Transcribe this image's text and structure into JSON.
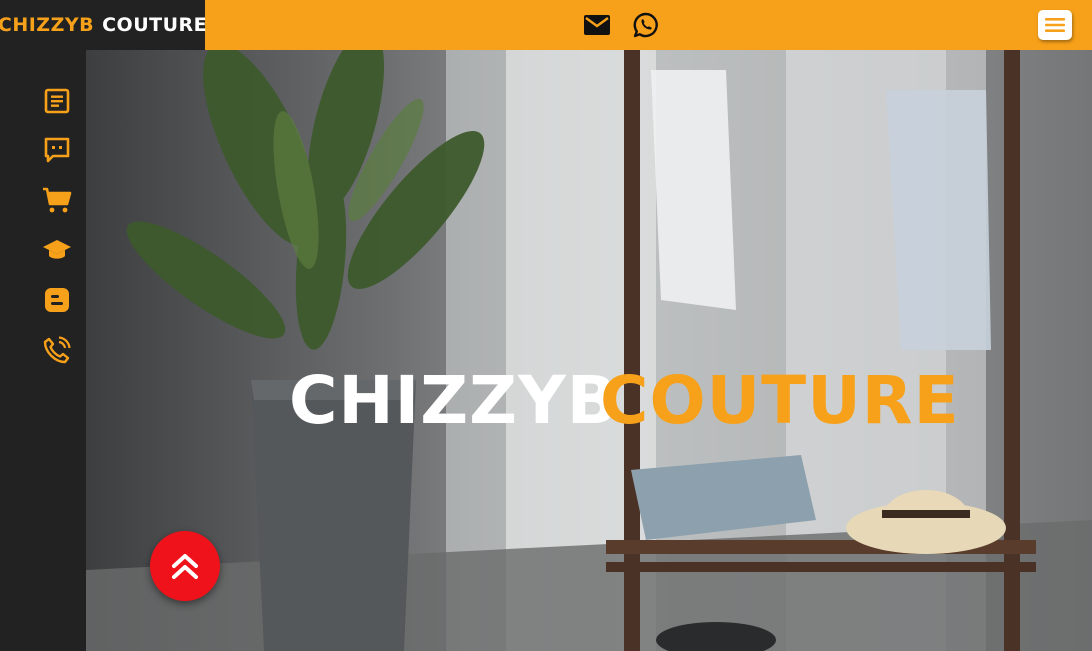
{
  "brand": {
    "part1": "CHIZZYB",
    "part2": "COUTURE"
  },
  "header": {
    "icons": [
      "mail-icon",
      "whatsapp-icon"
    ],
    "menu_icon": "hamburger-menu-icon"
  },
  "sidebar": {
    "items": [
      {
        "icon": "article-icon"
      },
      {
        "icon": "chat-icon"
      },
      {
        "icon": "cart-icon"
      },
      {
        "icon": "graduation-cap-icon"
      },
      {
        "icon": "blogger-icon"
      },
      {
        "icon": "phone-call-icon"
      }
    ]
  },
  "hero": {
    "title_part1": "CHIZZYB",
    "title_part2": "COUTURE"
  },
  "scroll_top": {
    "icon": "double-chevron-up-icon"
  },
  "colors": {
    "accent": "#f7a11a",
    "dark": "#222222",
    "scroll_button": "#f0121a"
  }
}
